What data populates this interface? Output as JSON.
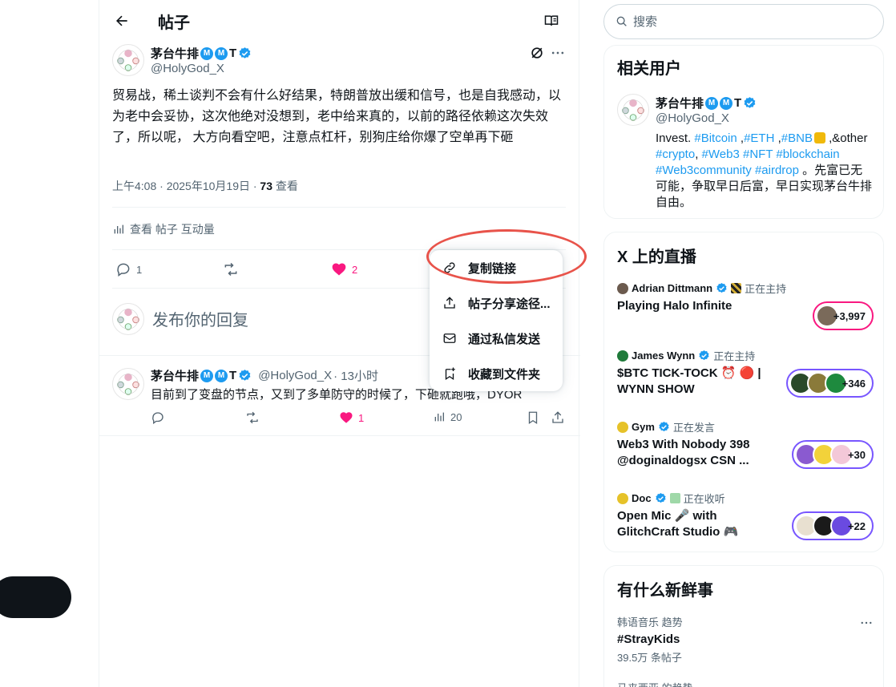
{
  "header": {
    "title": "帖子"
  },
  "tweet": {
    "display_name": "茅台牛排",
    "name_badges": [
      "M",
      "M"
    ],
    "name_suffix": "T",
    "handle": "@HolyGod_X",
    "text": "贸易战，稀土谈判不会有什么好结果，特朗普放出缓和信号，也是自我感动，以为老中会妥协，这次他绝对没想到，老中给来真的，以前的路径依赖这次失效了，所以呢， 大方向看空吧，注意点杠杆，别狗庄给你爆了空单再下砸",
    "timestamp": "上午4:08 · 2025年10月19日 · ",
    "views_count": "73",
    "views_label": " 查看",
    "analytics_label": "查看 帖子 互动量",
    "reply_count": "1",
    "like_count": "2"
  },
  "reply_box": {
    "placeholder": "发布你的回复"
  },
  "menu": {
    "items": [
      "复制链接",
      "帖子分享途径...",
      "通过私信发送",
      "收藏到文件夹"
    ]
  },
  "reply_tweet": {
    "display_name": "茅台牛排",
    "name_suffix": "T",
    "handle": "@HolyGod_X",
    "time": " · 13小时",
    "text": "目前到了变盘的节点，又到了多单防守的时候了，下砸就跑哦，DYOR",
    "like_count": "1",
    "views_count": "20"
  },
  "sidebar": {
    "search_placeholder": "搜索",
    "related_users": {
      "title": "相关用户",
      "display_name": "茅台牛排",
      "name_suffix": "T",
      "handle": "@HolyGod_X",
      "bio_parts": [
        "Invest. ",
        "#Bitcoin",
        " ,",
        "#ETH",
        " ,",
        "#BNB",
        " ,&other ",
        "#crypto",
        ", ",
        "#Web3",
        " ",
        "#NFT",
        " ",
        "#blockchain",
        " ",
        "#Web3community",
        " ",
        "#airdrop",
        " 。先富已无可能，争取早日后富，早日实现茅台牛排自由。"
      ]
    },
    "live": {
      "title": "X 上的直播",
      "items": [
        {
          "host": "Adrian Dittmann",
          "status": "正在主持",
          "title": "Playing Halo Infinite",
          "count": "+3,997"
        },
        {
          "host": "James Wynn",
          "status": "正在主持",
          "title": "$BTC TICK-TOCK ⏰ 🔴 | WYNN SHOW",
          "count": "+346"
        },
        {
          "host": "Gym",
          "status": "正在发言",
          "title": "Web3 With Nobody 398 @doginaldogsx CSN ...",
          "count": "+30"
        },
        {
          "host": "Doc",
          "status": "正在收听",
          "title": "Open Mic 🎤 with GlitchCraft Studio 🎮",
          "count": "+22"
        }
      ]
    },
    "trends": {
      "title": "有什么新鲜事",
      "items": [
        {
          "context": "韩语音乐 趋势",
          "name": "#StrayKids",
          "count": "39.5万 条帖子"
        },
        {
          "context": "马来西亚 的趋势"
        }
      ]
    }
  },
  "colors": {
    "accent": "#1d9bf0",
    "like": "#f91880",
    "highlight": "#e8534a",
    "live_ring": "#7856ff"
  }
}
